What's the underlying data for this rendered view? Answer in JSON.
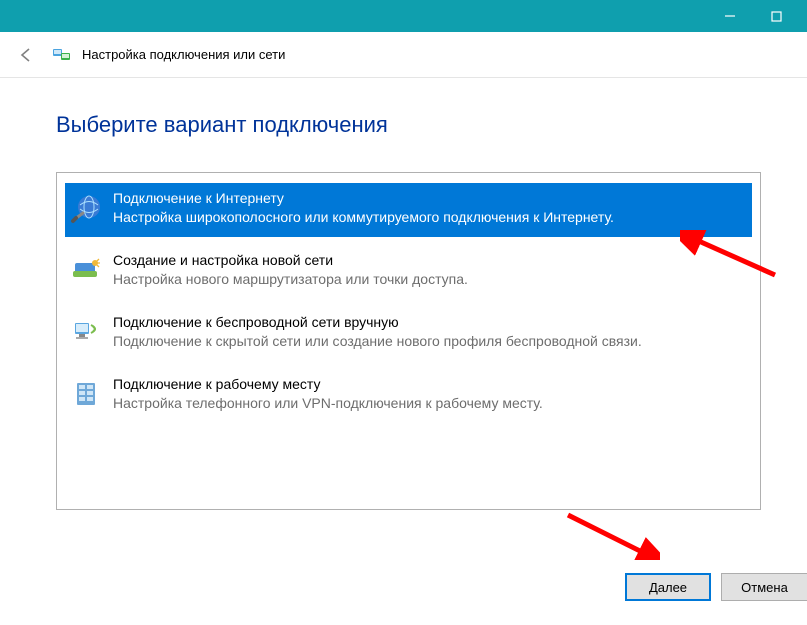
{
  "titlebar": {
    "minimize": "—",
    "maximize": "☐"
  },
  "wizard": {
    "title": "Настройка подключения или сети"
  },
  "heading": "Выберите вариант подключения",
  "options": [
    {
      "title": "Подключение к Интернету",
      "desc": "Настройка широкополосного или коммутируемого подключения к Интернету."
    },
    {
      "title": "Создание и настройка новой сети",
      "desc": "Настройка нового маршрутизатора или точки доступа."
    },
    {
      "title": "Подключение к беспроводной сети вручную",
      "desc": "Подключение к скрытой сети или создание нового профиля беспроводной связи."
    },
    {
      "title": "Подключение к рабочему месту",
      "desc": "Настройка телефонного или VPN-подключения к рабочему месту."
    }
  ],
  "buttons": {
    "next": "Далее",
    "cancel": "Отмена"
  }
}
